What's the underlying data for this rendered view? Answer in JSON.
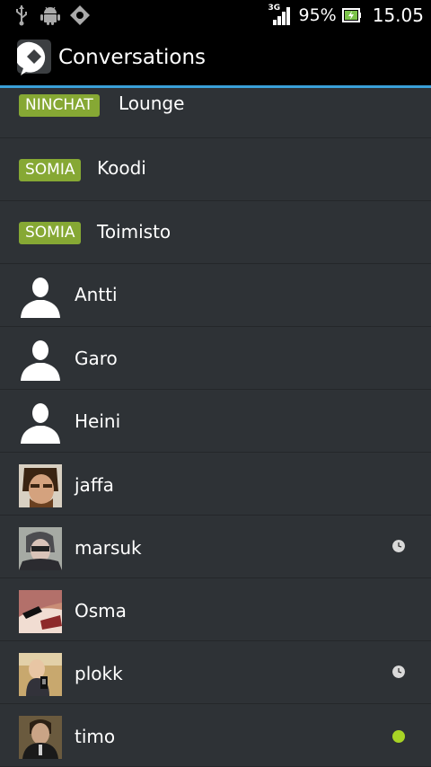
{
  "status_bar": {
    "network": "3G",
    "battery_percent": "95%",
    "time": "15.05"
  },
  "action_bar": {
    "title": "Conversations"
  },
  "channels": [
    {
      "badge": "NINCHAT",
      "name": "Lounge"
    },
    {
      "badge": "SOMIA",
      "name": "Koodi"
    },
    {
      "badge": "SOMIA",
      "name": "Toimisto"
    }
  ],
  "contacts": [
    {
      "name": "Antti",
      "avatar": "default-person-icon",
      "status": ""
    },
    {
      "name": "Garo",
      "avatar": "default-person-icon",
      "status": ""
    },
    {
      "name": "Heini",
      "avatar": "default-person-icon",
      "status": ""
    },
    {
      "name": "jaffa",
      "avatar": "photo",
      "status": ""
    },
    {
      "name": "marsuk",
      "avatar": "photo",
      "status": "idle-clock-icon"
    },
    {
      "name": "Osma",
      "avatar": "photo",
      "status": ""
    },
    {
      "name": "plokk",
      "avatar": "photo",
      "status": "idle-clock-icon"
    },
    {
      "name": "timo",
      "avatar": "photo",
      "status": "online-dot-icon"
    }
  ],
  "colors": {
    "badge": "#86a834",
    "accent": "#3aa0d8",
    "online": "#a8d425"
  }
}
